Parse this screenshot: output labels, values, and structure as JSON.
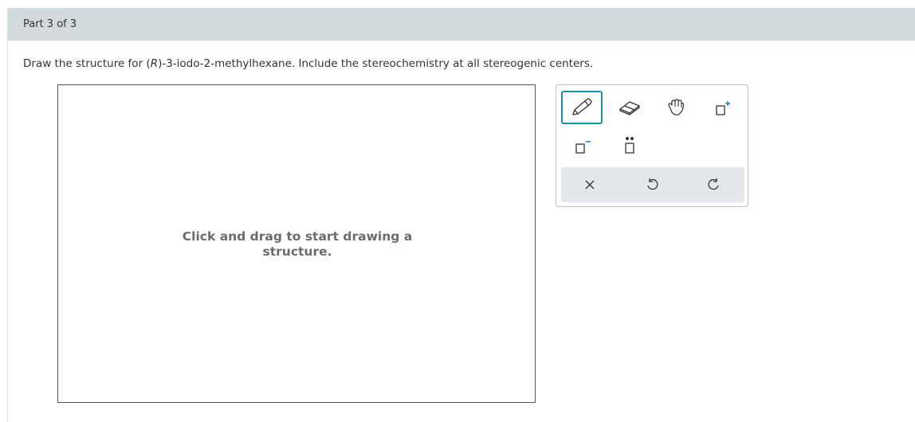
{
  "header": {
    "part_label": "Part 3 of 3"
  },
  "question": {
    "prefix": "Draw the structure for (",
    "italic": "R",
    "suffix": ")-3-iodo-2-methylhexane. Include the stereochemistry at all stereogenic centers."
  },
  "canvas": {
    "hint_line1": "Click and drag to start drawing a",
    "hint_line2": "structure."
  },
  "palette": {
    "tools": [
      {
        "name": "pencil",
        "icon": "pencil-icon",
        "selected": true
      },
      {
        "name": "eraser",
        "icon": "eraser-icon"
      },
      {
        "name": "move",
        "icon": "hand-icon"
      },
      {
        "name": "positive-charge",
        "icon": "square-plus-icon"
      },
      {
        "name": "negative-charge",
        "icon": "square-minus-icon"
      },
      {
        "name": "lone-pair",
        "icon": "square-dots-icon"
      }
    ],
    "actions": [
      {
        "name": "clear",
        "icon": "close-icon"
      },
      {
        "name": "undo",
        "icon": "undo-icon"
      },
      {
        "name": "redo",
        "icon": "redo-icon"
      }
    ]
  },
  "colors": {
    "accent": "#1a8fb0",
    "header_bg": "#d3dadd"
  }
}
